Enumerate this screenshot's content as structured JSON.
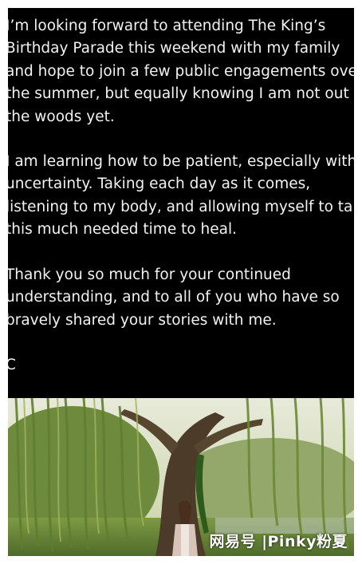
{
  "post": {
    "paragraphs": [
      "I’m looking forward to attending The King’s\nBirthday Parade this weekend with my family\nand hope to join a few public engagements over\nthe summer, but equally knowing I am not out of\nthe woods yet.",
      "I am learning how to be patient, especially with\nuncertainty. Taking each day as it comes,\nlistening to my body, and allowing myself to take\nthis much needed time to heal.",
      "Thank you so much for your continued\nunderstanding, and to all of you who have so\nbravely shared your stories with me."
    ],
    "signature": "C"
  },
  "watermark": "网易号 |Pinky粉夏",
  "colors": {
    "panel_background": "#000000",
    "text": "#f2f2f2"
  }
}
